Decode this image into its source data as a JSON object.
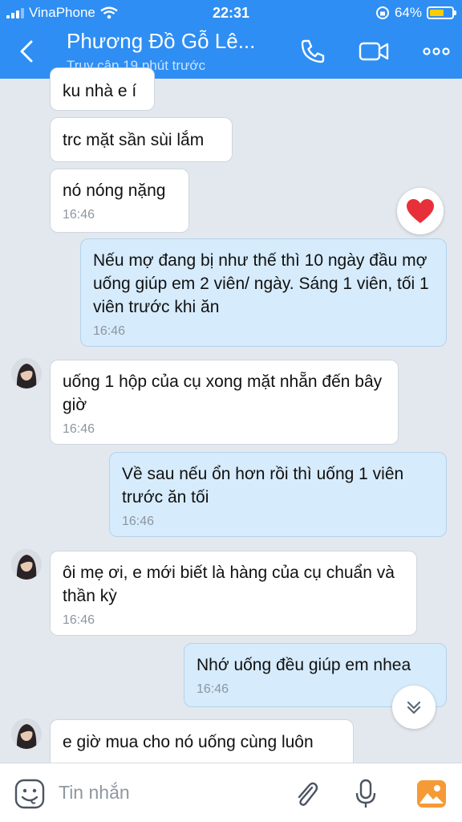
{
  "status_bar": {
    "carrier": "VinaPhone",
    "time": "22:31",
    "battery": "64%",
    "battery_level": 0.64
  },
  "header": {
    "title": "Phương Đồ Gỗ Lê...",
    "subtitle": "Truy cập 19 phút trước"
  },
  "messages": [
    {
      "text": "ku nhà e í",
      "time": ""
    },
    {
      "text": "trc mặt sần sùi lắm",
      "time": ""
    },
    {
      "text": "nó nóng nặng",
      "time": "16:46"
    },
    {
      "text": "Nếu mợ đang bị như thế thì 10 ngày đầu mợ uống giúp em 2 viên/ ngày. Sáng 1 viên, tối 1 viên trước khi ăn",
      "time": "16:46"
    },
    {
      "text": "uống 1 hộp của cụ xong mặt nhẵn đến bây giờ",
      "time": "16:46"
    },
    {
      "text": "Về sau nếu ổn hơn rồi thì uống 1 viên trước ăn tối",
      "time": "16:46"
    },
    {
      "text": "ôi mẹ ơi, e mới biết là hàng của cụ chuẩn và thần kỳ",
      "time": "16:46"
    },
    {
      "text": "Nhớ uống đều giúp em nhea",
      "time": "16:46"
    },
    {
      "text": "e giờ mua cho nó uống cùng luôn",
      "time": ""
    }
  ],
  "input": {
    "placeholder": "Tin nhắn"
  },
  "colors": {
    "header": "#2e8ef3",
    "sent_bubble": "#d6ebfb",
    "received_bubble": "#ffffff",
    "reaction_heart": "#e8303a"
  },
  "icons": [
    "back-icon",
    "phone-icon",
    "video-call-icon",
    "more-icon",
    "heart-icon",
    "chevron-down-icon",
    "sticker-icon",
    "attachment-icon",
    "microphone-icon",
    "image-icon"
  ]
}
